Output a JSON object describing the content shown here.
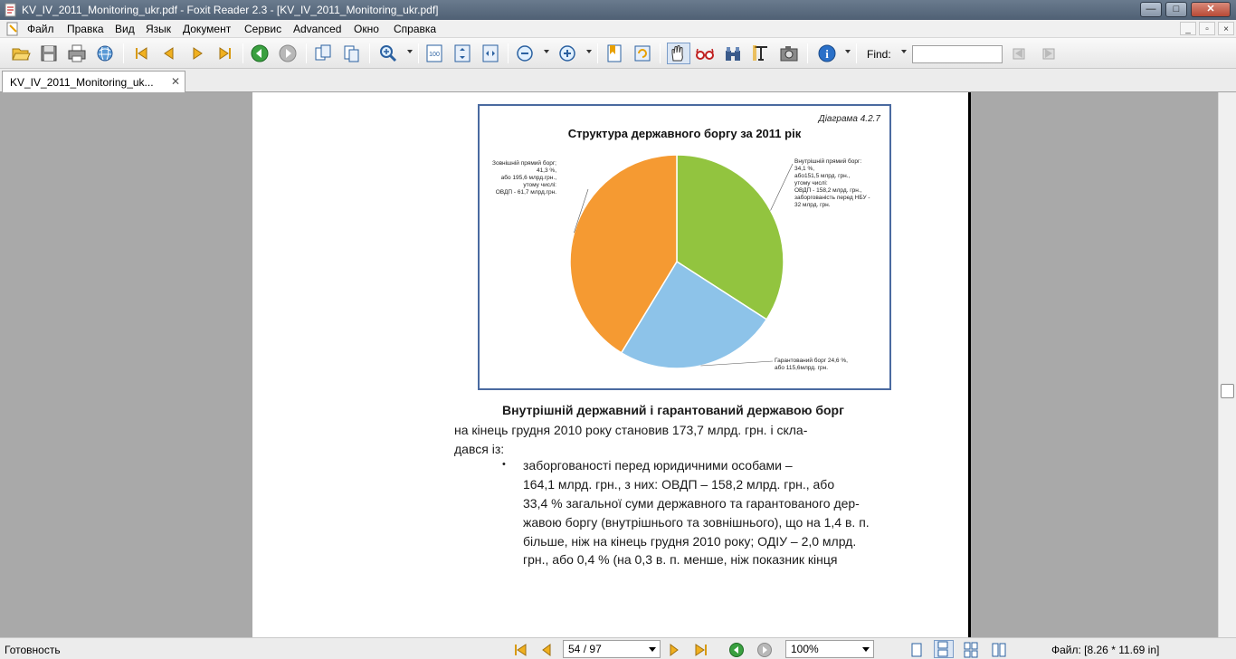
{
  "window": {
    "title": "KV_IV_2011_Monitoring_ukr.pdf - Foxit Reader 2.3 - [KV_IV_2011_Monitoring_ukr.pdf]",
    "buttons": {
      "minimize": "—",
      "maximize": "□",
      "close": "✕"
    }
  },
  "menu": {
    "items": [
      "Файл",
      "Правка",
      "Вид",
      "Язык",
      "Документ",
      "Сервис",
      "Advanced",
      "Окно",
      "Справка"
    ],
    "mdi_buttons": [
      "_",
      "▫",
      "×"
    ]
  },
  "toolbar": {
    "icons": [
      "open-icon",
      "save-icon",
      "print-icon",
      "web-icon",
      "first-page-icon",
      "prev-page-icon",
      "next-page-icon",
      "last-page-icon",
      "back-icon",
      "forward-icon",
      "rotate-icon",
      "single-page-icon",
      "zoom-in-icon",
      "actual-size-icon",
      "fit-page-icon",
      "fit-width-icon",
      "zoom-out-minus-icon",
      "zoom-in-plus-icon",
      "bookmark-icon",
      "rotate-view-icon",
      "hand-tool-icon",
      "glasses-icon",
      "binoculars-icon",
      "text-select-icon",
      "snapshot-icon",
      "info-icon"
    ],
    "find_label": "Find:",
    "find_value": ""
  },
  "tab": {
    "label": "KV_IV_2011_Monitoring_uk...",
    "close": "✕"
  },
  "document": {
    "diagram_number": "Діаграма 4.2.7",
    "chart_title": "Структура державного боргу за 2011 рік",
    "paragraph_title": "Внутрішній державний і гарантований державою борг",
    "lines": [
      "на кінець грудня 2010 року становив 173,7 млрд. грн. і скла-",
      "дався із:",
      "заборгованості    перед    юридичними    особами    –",
      "164,1 млрд. грн., з них: ОВДП – 158,2 млрд. грн., або",
      "33,4 % загальної суми державного та гарантованого дер-",
      "жавою боргу (внутрішнього та зовнішнього), що на 1,4 в. п.",
      "більше, ніж на кінець грудня 2010 року; ОДІУ – 2,0 млрд.",
      "грн., або 0,4 % (на 0,3 в. п. менше, ніж показник кінця"
    ],
    "bullet": "•"
  },
  "chart_data": {
    "type": "pie",
    "title": "Структура державного боргу за 2011 рік",
    "slices": [
      {
        "label": "Внутрішній прямий борг",
        "value": 34.1,
        "color": "#92c43f",
        "text": [
          "Внутрішній прямий борг:",
          "34,1 %,",
          "або151,5 млрд. грн.,",
          "утому числі:",
          "ОВДП - 158,2 млрд. грн.,",
          "заборгованість перед НБУ -",
          "32 млрд. грн."
        ]
      },
      {
        "label": "Гарантований борг",
        "value": 24.6,
        "color": "#8dc3e9",
        "text": [
          "Гарантований борг 24,6 %,",
          "або 115,6млрд. грн."
        ]
      },
      {
        "label": "Зовнішній прямий борг",
        "value": 41.3,
        "color": "#f59a32",
        "text": [
          "Зовнішній прямий борг;",
          "41,3 %,",
          "або 195,6 млрд.грн.,",
          "утому числі:",
          "ОВДП - 61,7 млрд.грн."
        ]
      }
    ]
  },
  "status": {
    "text": "Готовность",
    "page_current": "54",
    "page_total": "97",
    "page_sep": "/",
    "zoom": "100%",
    "file_size": "Файл: [8.26 * 11.69 in]"
  }
}
